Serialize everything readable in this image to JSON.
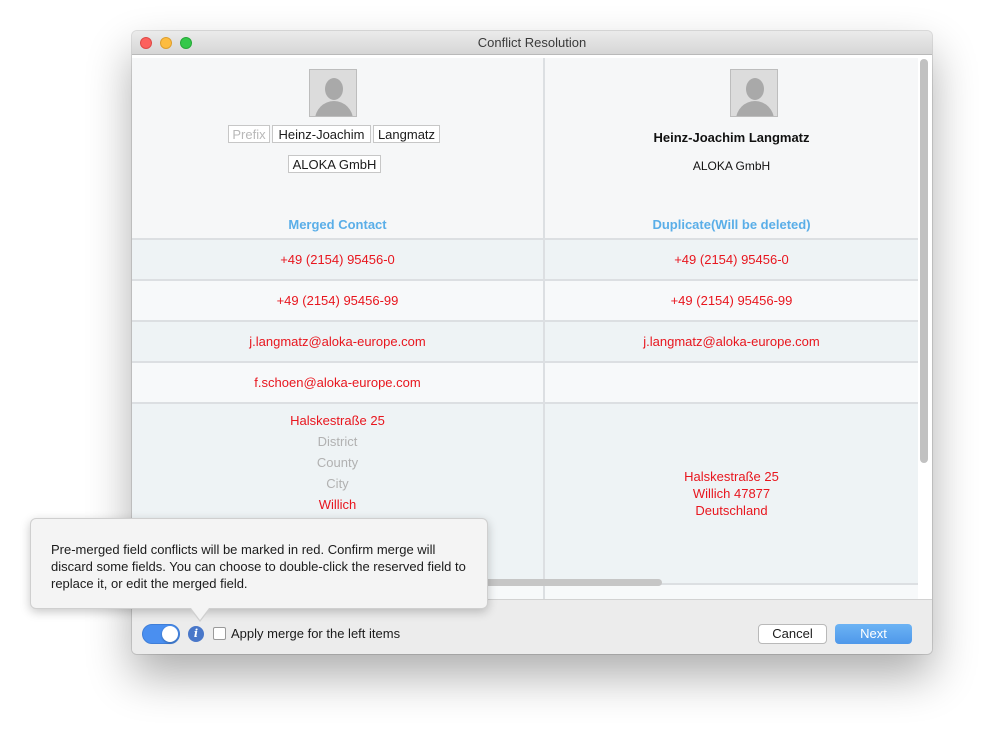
{
  "window": {
    "title": "Conflict Resolution"
  },
  "left_header": {
    "prefix_placeholder": "Prefix",
    "first_name": "Heinz-Joachim",
    "last_name": "Langmatz",
    "company": "ALOKA GmbH",
    "column_label": "Merged Contact"
  },
  "right_header": {
    "full_name": "Heinz-Joachim Langmatz",
    "company": "ALOKA GmbH",
    "column_label": "Duplicate(Will be deleted)"
  },
  "rows": [
    {
      "left": "+49 (2154) 95456-0",
      "right": "+49 (2154) 95456-0"
    },
    {
      "left": "+49 (2154) 95456-99",
      "right": "+49 (2154) 95456-99"
    },
    {
      "left": "j.langmatz@aloka-europe.com",
      "right": "j.langmatz@aloka-europe.com"
    },
    {
      "left": "f.schoen@aloka-europe.com",
      "right": ""
    }
  ],
  "address": {
    "left": {
      "street": "Halskestraße 25",
      "district_placeholder": "District",
      "county_placeholder": "County",
      "city_placeholder": "City",
      "city": "Willich"
    },
    "right": {
      "line1": "Halskestraße 25",
      "line2": "Willich 47877",
      "line3": "Deutschland"
    }
  },
  "tooltip": {
    "text": "Pre-merged field conflicts will be marked in red. Confirm merge will discard some fields. You can choose to double-click the reserved field to replace it, or edit the merged field."
  },
  "footer": {
    "info_glyph": "i",
    "checkbox_label": "Apply merge for the left items",
    "cancel_label": "Cancel",
    "next_label": "Next"
  },
  "colors": {
    "conflict_red": "#e8161e",
    "accent_blue": "#5aaee8",
    "next_button": "#4e98ea",
    "toggle_on": "#4a8ff0"
  },
  "toggle": {
    "state": "on"
  },
  "checkbox": {
    "checked": false
  }
}
